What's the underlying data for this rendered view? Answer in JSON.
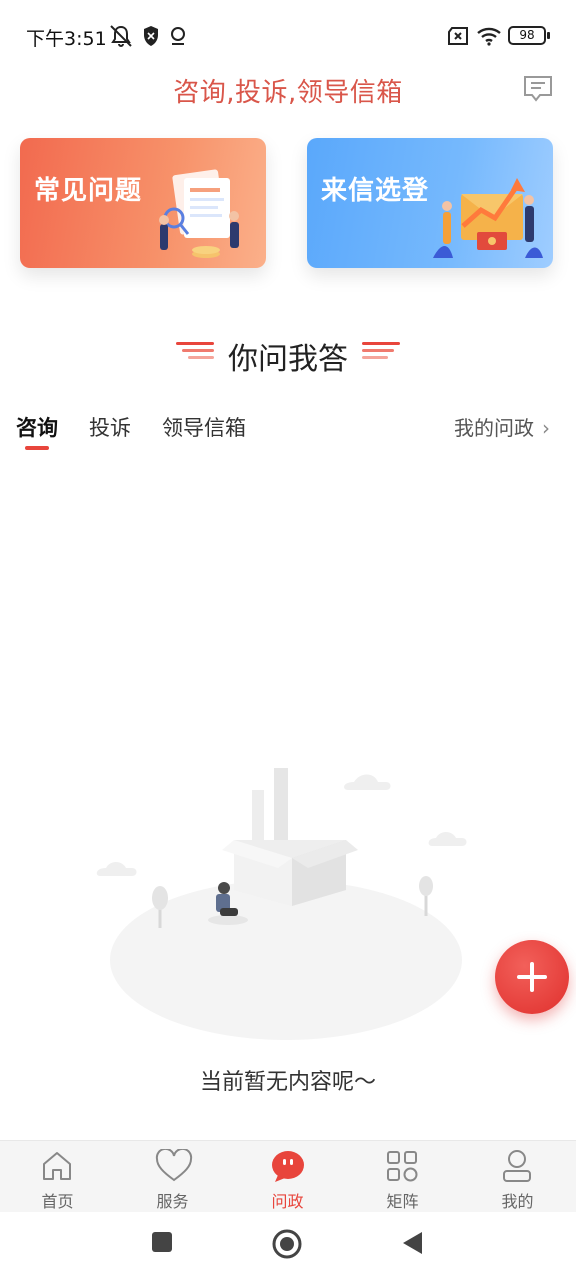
{
  "status_bar": {
    "time": "下午3:51",
    "battery": "98"
  },
  "header": {
    "title": "咨询,投诉,领导信箱",
    "right_icon": "feedback-note-icon"
  },
  "cards": [
    {
      "label": "常见问题",
      "color": "#f26a4f"
    },
    {
      "label": "来信选登",
      "color": "#5aa8fb"
    }
  ],
  "section": {
    "title": "你问我答"
  },
  "tabs": {
    "items": [
      {
        "label": "咨询",
        "active": true
      },
      {
        "label": "投诉",
        "active": false
      },
      {
        "label": "领导信箱",
        "active": false
      }
    ],
    "my_questions": "我的问政"
  },
  "empty_state": {
    "text": "当前暂无内容呢〜"
  },
  "fab": {
    "icon": "plus-icon",
    "color": "#e8453c"
  },
  "bottom_nav": {
    "items": [
      {
        "label": "首页",
        "icon": "home-icon"
      },
      {
        "label": "服务",
        "icon": "heart-icon"
      },
      {
        "label": "问政",
        "icon": "chat-bubble-icon",
        "active": true
      },
      {
        "label": "矩阵",
        "icon": "grid-icon"
      },
      {
        "label": "我的",
        "icon": "user-icon"
      }
    ],
    "active_color": "#e8453c"
  },
  "system_nav": {
    "buttons": [
      "square-recents-icon",
      "circle-home-icon",
      "triangle-back-icon"
    ]
  }
}
